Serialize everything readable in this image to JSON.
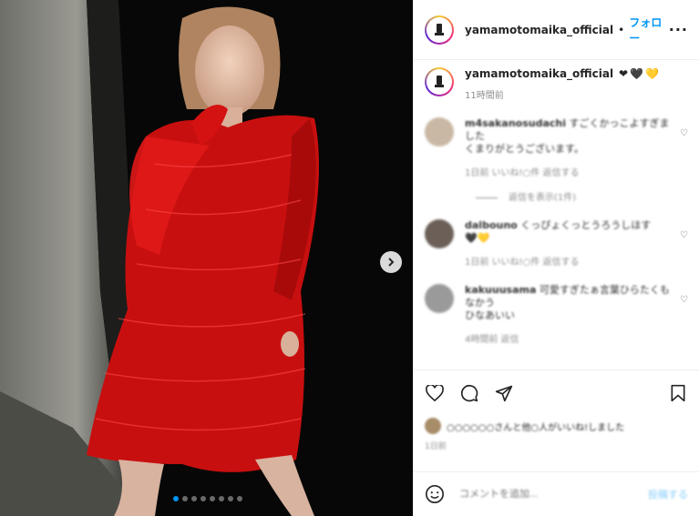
{
  "header": {
    "username": "yamamotomaika_official",
    "separator": "•",
    "follow": "フォロー",
    "more": "···"
  },
  "caption": {
    "username": "yamamotomaika_official",
    "hearts": [
      "❤",
      "🖤",
      "💛"
    ],
    "time": "11時間前"
  },
  "comments": [
    {
      "user": "m4sakanosudachi",
      "text": "すごくかっこよすぎました",
      "text2": "くまりがとうございます。",
      "meta": "1日前  いいね!○件  返信する",
      "replies": "返信を表示(1件)"
    },
    {
      "user": "dalbouno",
      "text": "くっぴょくっとうろうしほす",
      "text2": "🖤💛",
      "meta": "1日前  いいね!○件  返信する"
    },
    {
      "user": "kakuuusama",
      "text": "可愛すぎたぁ言葉ひらたくもなかう",
      "text2": "ひなあいい",
      "meta": "4時間前  返信"
    }
  ],
  "likes": {
    "text": "○○○○○○さんと他○人がいいね!しました"
  },
  "post_time": "1日前",
  "add_comment": {
    "placeholder": "コメントを追加...",
    "post": "投稿する"
  },
  "carousel": {
    "count": 8,
    "active": 0
  },
  "colors": {
    "accent": "#0095f6",
    "dress": "#d01010"
  }
}
